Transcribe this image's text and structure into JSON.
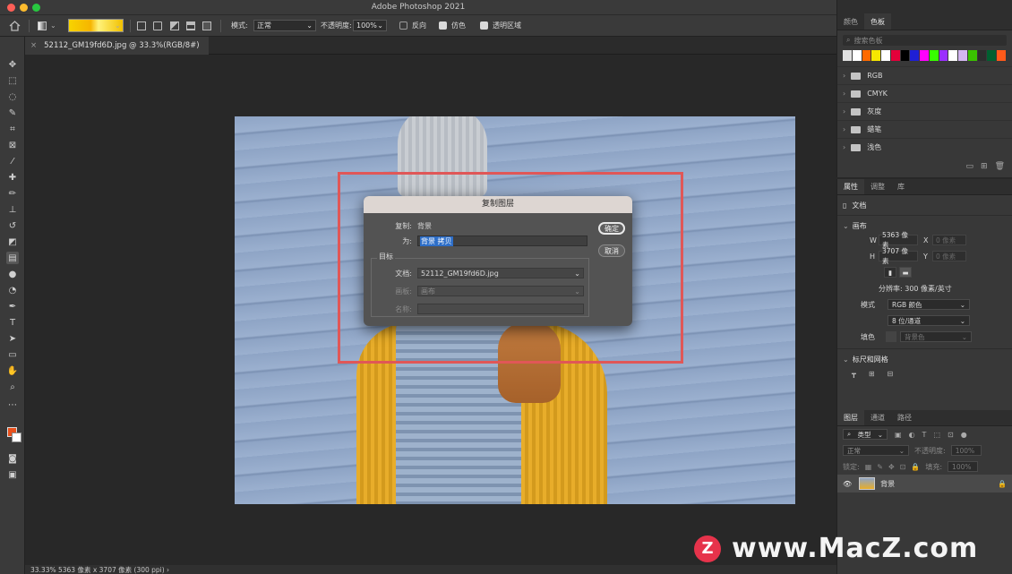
{
  "window": {
    "title": "Adobe Photoshop 2021"
  },
  "options_bar": {
    "mode_label": "模式:",
    "mode_value": "正常",
    "opacity_label": "不透明度:",
    "opacity_value": "100%",
    "reverse_label": "反向",
    "dither_label": "仿色",
    "transparency_label": "透明区域"
  },
  "document_tab": {
    "title": "52112_GM19fd6D.jpg @ 33.3%(RGB/8#)",
    "close": "×"
  },
  "status_bar": {
    "text": "33.33%   5363 像素 x 3707 像素 (300 ppi)  ›"
  },
  "dialog": {
    "title": "复制图层",
    "duplicate_label": "复制:",
    "duplicate_value": "背景",
    "as_label": "为:",
    "as_value": "背景 拷贝",
    "ok_label": "确定",
    "cancel_label": "取消",
    "target_title": "目标",
    "document_label": "文档:",
    "document_value": "52112_GM19fd6D.jpg",
    "artboard_label": "画板:",
    "artboard_value": "画布",
    "name_label": "名称:",
    "name_value": ""
  },
  "swatches_panel": {
    "tabs": [
      "颜色",
      "色板"
    ],
    "search_placeholder": "搜索色板",
    "colors": [
      "#e0e0e0",
      "#ffffff",
      "#ff6a00",
      "#f6e600",
      "#ffffff",
      "#e4003a",
      "#000000",
      "#1f1fd6",
      "#ff00ff",
      "#37ff00",
      "#9b30ff",
      "#ffffff",
      "#d3b6f0",
      "#3ac100",
      "#2d2d2d",
      "#006030",
      "#ff5a1a"
    ],
    "groups": [
      "RGB",
      "CMYK",
      "灰度",
      "蜡笔",
      "浅色"
    ]
  },
  "properties_panel": {
    "tabs": [
      "属性",
      "调整",
      "库"
    ],
    "doc_label": "文档",
    "canvas_label": "画布",
    "w_label": "W",
    "w_value": "5363 像素",
    "x_label": "X",
    "x_value": "0 像素",
    "h_label": "H",
    "h_value": "3707 像素",
    "y_label": "Y",
    "y_value": "0 像素",
    "resolution": "分辨率: 300 像素/英寸",
    "mode_label": "模式",
    "mode_value": "RGB 颜色",
    "depth_value": "8 位/通道",
    "fill_label": "填色",
    "fill_value": "背景色",
    "rulers_label": "标尺和网格"
  },
  "layers_panel": {
    "tabs": [
      "图层",
      "通道",
      "路径"
    ],
    "filter_label": "类型",
    "blend_value": "正常",
    "opacity_label": "不透明度:",
    "opacity_value": "100%",
    "lock_label": "锁定:",
    "fill_label": "填充:",
    "fill_value": "100%",
    "layers": [
      {
        "name": "背景",
        "visible": true,
        "locked": true
      }
    ]
  },
  "watermark": {
    "logo": "Z",
    "text": "www.MacZ.com"
  }
}
